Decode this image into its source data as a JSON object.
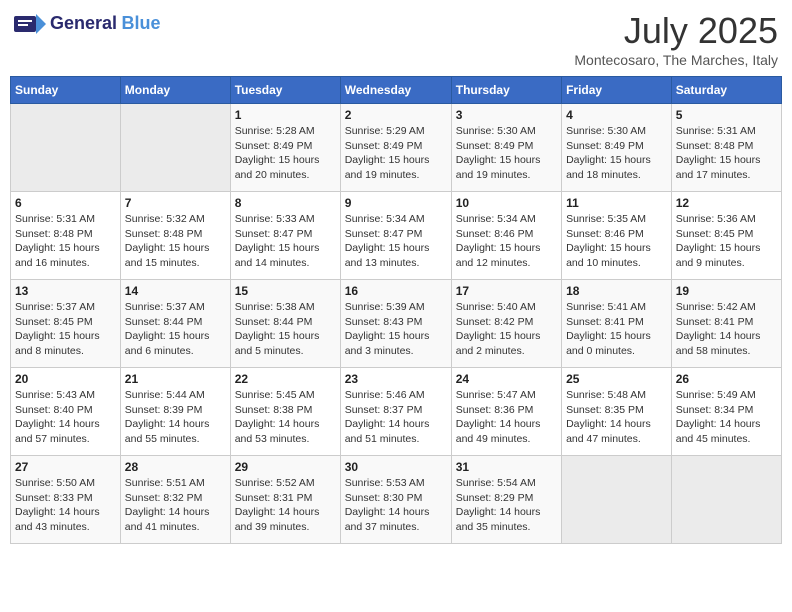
{
  "header": {
    "logo_general": "General",
    "logo_blue": "Blue",
    "title": "July 2025",
    "subtitle": "Montecosaro, The Marches, Italy"
  },
  "weekdays": [
    "Sunday",
    "Monday",
    "Tuesday",
    "Wednesday",
    "Thursday",
    "Friday",
    "Saturday"
  ],
  "weeks": [
    [
      {
        "day": "",
        "empty": true
      },
      {
        "day": "",
        "empty": true
      },
      {
        "day": "1",
        "sunrise": "Sunrise: 5:28 AM",
        "sunset": "Sunset: 8:49 PM",
        "daylight": "Daylight: 15 hours and 20 minutes."
      },
      {
        "day": "2",
        "sunrise": "Sunrise: 5:29 AM",
        "sunset": "Sunset: 8:49 PM",
        "daylight": "Daylight: 15 hours and 19 minutes."
      },
      {
        "day": "3",
        "sunrise": "Sunrise: 5:30 AM",
        "sunset": "Sunset: 8:49 PM",
        "daylight": "Daylight: 15 hours and 19 minutes."
      },
      {
        "day": "4",
        "sunrise": "Sunrise: 5:30 AM",
        "sunset": "Sunset: 8:49 PM",
        "daylight": "Daylight: 15 hours and 18 minutes."
      },
      {
        "day": "5",
        "sunrise": "Sunrise: 5:31 AM",
        "sunset": "Sunset: 8:48 PM",
        "daylight": "Daylight: 15 hours and 17 minutes."
      }
    ],
    [
      {
        "day": "6",
        "sunrise": "Sunrise: 5:31 AM",
        "sunset": "Sunset: 8:48 PM",
        "daylight": "Daylight: 15 hours and 16 minutes."
      },
      {
        "day": "7",
        "sunrise": "Sunrise: 5:32 AM",
        "sunset": "Sunset: 8:48 PM",
        "daylight": "Daylight: 15 hours and 15 minutes."
      },
      {
        "day": "8",
        "sunrise": "Sunrise: 5:33 AM",
        "sunset": "Sunset: 8:47 PM",
        "daylight": "Daylight: 15 hours and 14 minutes."
      },
      {
        "day": "9",
        "sunrise": "Sunrise: 5:34 AM",
        "sunset": "Sunset: 8:47 PM",
        "daylight": "Daylight: 15 hours and 13 minutes."
      },
      {
        "day": "10",
        "sunrise": "Sunrise: 5:34 AM",
        "sunset": "Sunset: 8:46 PM",
        "daylight": "Daylight: 15 hours and 12 minutes."
      },
      {
        "day": "11",
        "sunrise": "Sunrise: 5:35 AM",
        "sunset": "Sunset: 8:46 PM",
        "daylight": "Daylight: 15 hours and 10 minutes."
      },
      {
        "day": "12",
        "sunrise": "Sunrise: 5:36 AM",
        "sunset": "Sunset: 8:45 PM",
        "daylight": "Daylight: 15 hours and 9 minutes."
      }
    ],
    [
      {
        "day": "13",
        "sunrise": "Sunrise: 5:37 AM",
        "sunset": "Sunset: 8:45 PM",
        "daylight": "Daylight: 15 hours and 8 minutes."
      },
      {
        "day": "14",
        "sunrise": "Sunrise: 5:37 AM",
        "sunset": "Sunset: 8:44 PM",
        "daylight": "Daylight: 15 hours and 6 minutes."
      },
      {
        "day": "15",
        "sunrise": "Sunrise: 5:38 AM",
        "sunset": "Sunset: 8:44 PM",
        "daylight": "Daylight: 15 hours and 5 minutes."
      },
      {
        "day": "16",
        "sunrise": "Sunrise: 5:39 AM",
        "sunset": "Sunset: 8:43 PM",
        "daylight": "Daylight: 15 hours and 3 minutes."
      },
      {
        "day": "17",
        "sunrise": "Sunrise: 5:40 AM",
        "sunset": "Sunset: 8:42 PM",
        "daylight": "Daylight: 15 hours and 2 minutes."
      },
      {
        "day": "18",
        "sunrise": "Sunrise: 5:41 AM",
        "sunset": "Sunset: 8:41 PM",
        "daylight": "Daylight: 15 hours and 0 minutes."
      },
      {
        "day": "19",
        "sunrise": "Sunrise: 5:42 AM",
        "sunset": "Sunset: 8:41 PM",
        "daylight": "Daylight: 14 hours and 58 minutes."
      }
    ],
    [
      {
        "day": "20",
        "sunrise": "Sunrise: 5:43 AM",
        "sunset": "Sunset: 8:40 PM",
        "daylight": "Daylight: 14 hours and 57 minutes."
      },
      {
        "day": "21",
        "sunrise": "Sunrise: 5:44 AM",
        "sunset": "Sunset: 8:39 PM",
        "daylight": "Daylight: 14 hours and 55 minutes."
      },
      {
        "day": "22",
        "sunrise": "Sunrise: 5:45 AM",
        "sunset": "Sunset: 8:38 PM",
        "daylight": "Daylight: 14 hours and 53 minutes."
      },
      {
        "day": "23",
        "sunrise": "Sunrise: 5:46 AM",
        "sunset": "Sunset: 8:37 PM",
        "daylight": "Daylight: 14 hours and 51 minutes."
      },
      {
        "day": "24",
        "sunrise": "Sunrise: 5:47 AM",
        "sunset": "Sunset: 8:36 PM",
        "daylight": "Daylight: 14 hours and 49 minutes."
      },
      {
        "day": "25",
        "sunrise": "Sunrise: 5:48 AM",
        "sunset": "Sunset: 8:35 PM",
        "daylight": "Daylight: 14 hours and 47 minutes."
      },
      {
        "day": "26",
        "sunrise": "Sunrise: 5:49 AM",
        "sunset": "Sunset: 8:34 PM",
        "daylight": "Daylight: 14 hours and 45 minutes."
      }
    ],
    [
      {
        "day": "27",
        "sunrise": "Sunrise: 5:50 AM",
        "sunset": "Sunset: 8:33 PM",
        "daylight": "Daylight: 14 hours and 43 minutes."
      },
      {
        "day": "28",
        "sunrise": "Sunrise: 5:51 AM",
        "sunset": "Sunset: 8:32 PM",
        "daylight": "Daylight: 14 hours and 41 minutes."
      },
      {
        "day": "29",
        "sunrise": "Sunrise: 5:52 AM",
        "sunset": "Sunset: 8:31 PM",
        "daylight": "Daylight: 14 hours and 39 minutes."
      },
      {
        "day": "30",
        "sunrise": "Sunrise: 5:53 AM",
        "sunset": "Sunset: 8:30 PM",
        "daylight": "Daylight: 14 hours and 37 minutes."
      },
      {
        "day": "31",
        "sunrise": "Sunrise: 5:54 AM",
        "sunset": "Sunset: 8:29 PM",
        "daylight": "Daylight: 14 hours and 35 minutes."
      },
      {
        "day": "",
        "empty": true
      },
      {
        "day": "",
        "empty": true
      }
    ]
  ]
}
